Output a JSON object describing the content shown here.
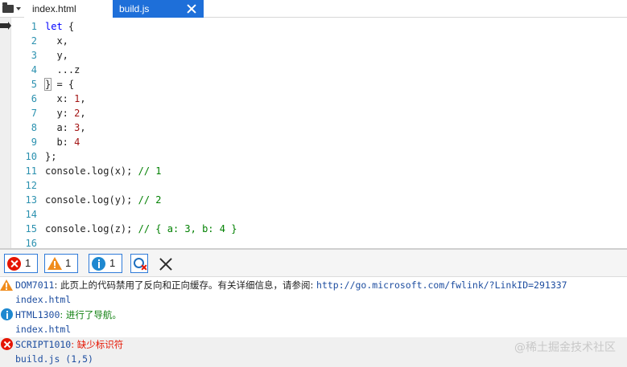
{
  "colors": {
    "accent": "#1e6fd9",
    "error": "#e51400",
    "warning": "#f08c1c",
    "info": "#1e88d0",
    "line_number": "#2b91af"
  },
  "tabs": [
    {
      "label": "index.html",
      "active": false
    },
    {
      "label": "build.js",
      "active": true
    }
  ],
  "editor": {
    "lines": [
      {
        "n": "1",
        "t": "let {"
      },
      {
        "n": "2",
        "t": "  x,"
      },
      {
        "n": "3",
        "t": "  y,"
      },
      {
        "n": "4",
        "t": "  ...z"
      },
      {
        "n": "5",
        "t": "} = {"
      },
      {
        "n": "6",
        "t": "  x: 1,"
      },
      {
        "n": "7",
        "t": "  y: 2,"
      },
      {
        "n": "8",
        "t": "  a: 3,"
      },
      {
        "n": "9",
        "t": "  b: 4"
      },
      {
        "n": "10",
        "t": "};"
      },
      {
        "n": "11",
        "t": "console.log(x); // 1"
      },
      {
        "n": "12",
        "t": ""
      },
      {
        "n": "13",
        "t": "console.log(y); // 2"
      },
      {
        "n": "14",
        "t": ""
      },
      {
        "n": "15",
        "t": "console.log(z); // { a: 3, b: 4 }"
      },
      {
        "n": "16",
        "t": ""
      }
    ]
  },
  "console": {
    "filters": {
      "errors": "1",
      "warnings": "1",
      "info": "1"
    },
    "messages": [
      {
        "severity": "warning",
        "code": "DOM7011",
        "sep": ": ",
        "text": "此页上的代码禁用了反向和正向缓存。有关详细信息，请参阅: ",
        "link": "http://go.microsoft.com/fwlink/?LinkID=291337",
        "source": "index.html"
      },
      {
        "severity": "info",
        "code": "HTML1300",
        "sep": ": ",
        "text": "进行了导航。",
        "source": "index.html"
      },
      {
        "severity": "error",
        "code": "SCRIPT1010",
        "sep": ": ",
        "text": "缺少标识符",
        "source": "build.js (1,5)"
      }
    ]
  },
  "watermark": "@稀土掘金技术社区"
}
